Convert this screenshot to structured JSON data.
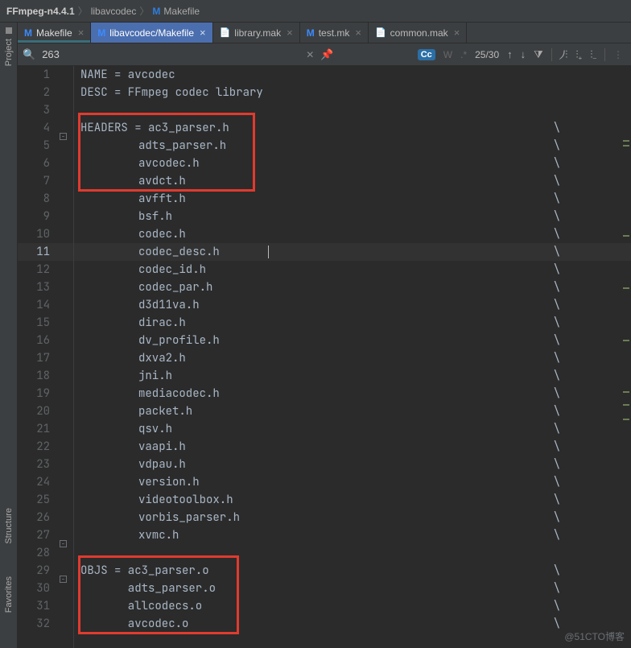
{
  "breadcrumb": {
    "root": "FFmpeg-n4.4.1",
    "folder": "libavcodec",
    "file": "Makefile"
  },
  "tabs": [
    {
      "icon": "M",
      "label": "Makefile",
      "active": false,
      "underline": true
    },
    {
      "icon": "M",
      "label": "libavcodec/Makefile",
      "active": true,
      "underline": false
    },
    {
      "icon": "F",
      "label": "library.mak",
      "active": false,
      "underline": false
    },
    {
      "icon": "M",
      "label": "test.mk",
      "active": false,
      "underline": false
    },
    {
      "icon": "F",
      "label": "common.mak",
      "active": false,
      "underline": false
    }
  ],
  "find": {
    "query": "263",
    "hits": "25/30",
    "cc": "Cc",
    "w": "W",
    "star": ".*",
    "up": "↑",
    "down": "↓",
    "filter": "⧩"
  },
  "side_tools": {
    "project": "Project",
    "structure": "Structure",
    "favorites": "Favorites"
  },
  "code": {
    "lines": [
      {
        "n": 1,
        "fold": "",
        "text": "NAME = avcodec",
        "bs": false
      },
      {
        "n": 2,
        "fold": "",
        "text": "DESC = FFmpeg codec library",
        "bs": false
      },
      {
        "n": 3,
        "fold": "",
        "text": "",
        "bs": false
      },
      {
        "n": 4,
        "fold": "-",
        "text": "HEADERS = ac3_parser.h",
        "bs": true
      },
      {
        "n": 5,
        "fold": "",
        "text": "",
        "pad": "adts_parser.h",
        "bs": true
      },
      {
        "n": 6,
        "fold": "",
        "text": "",
        "pad": "avcodec.h",
        "bs": true
      },
      {
        "n": 7,
        "fold": "",
        "text": "",
        "pad": "avdct.h",
        "bs": true
      },
      {
        "n": 8,
        "fold": "",
        "text": "",
        "pad": "avfft.h",
        "bs": true
      },
      {
        "n": 9,
        "fold": "",
        "text": "",
        "pad": "bsf.h",
        "bs": true
      },
      {
        "n": 10,
        "fold": "",
        "text": "",
        "pad": "codec.h",
        "bs": true
      },
      {
        "n": 11,
        "fold": "",
        "text": "",
        "pad": "codec_desc.h",
        "bs": true,
        "current": true
      },
      {
        "n": 12,
        "fold": "",
        "text": "",
        "pad": "codec_id.h",
        "bs": true
      },
      {
        "n": 13,
        "fold": "",
        "text": "",
        "pad": "codec_par.h",
        "bs": true
      },
      {
        "n": 14,
        "fold": "",
        "text": "",
        "pad": "d3d11va.h",
        "bs": true
      },
      {
        "n": 15,
        "fold": "",
        "text": "",
        "pad": "dirac.h",
        "bs": true
      },
      {
        "n": 16,
        "fold": "",
        "text": "",
        "pad": "dv_profile.h",
        "bs": true
      },
      {
        "n": 17,
        "fold": "",
        "text": "",
        "pad": "dxva2.h",
        "bs": true
      },
      {
        "n": 18,
        "fold": "",
        "text": "",
        "pad": "jni.h",
        "bs": true
      },
      {
        "n": 19,
        "fold": "",
        "text": "",
        "pad": "mediacodec.h",
        "bs": true
      },
      {
        "n": 20,
        "fold": "",
        "text": "",
        "pad": "packet.h",
        "bs": true
      },
      {
        "n": 21,
        "fold": "",
        "text": "",
        "pad": "qsv.h",
        "bs": true
      },
      {
        "n": 22,
        "fold": "",
        "text": "",
        "pad": "vaapi.h",
        "bs": true
      },
      {
        "n": 23,
        "fold": "",
        "text": "",
        "pad": "vdpau.h",
        "bs": true
      },
      {
        "n": 24,
        "fold": "",
        "text": "",
        "pad": "version.h",
        "bs": true
      },
      {
        "n": 25,
        "fold": "",
        "text": "",
        "pad": "videotoolbox.h",
        "bs": true
      },
      {
        "n": 26,
        "fold": "",
        "text": "",
        "pad": "vorbis_parser.h",
        "bs": true
      },
      {
        "n": 27,
        "fold": "-",
        "text": "",
        "pad": "xvmc.h",
        "bs": true
      },
      {
        "n": 28,
        "fold": "",
        "text": "",
        "bs": false
      },
      {
        "n": 29,
        "fold": "-",
        "text": "OBJS = ac3_parser.o",
        "bs": true
      },
      {
        "n": 30,
        "fold": "",
        "text": "",
        "pad2": "adts_parser.o",
        "bs": true
      },
      {
        "n": 31,
        "fold": "",
        "text": "",
        "pad2": "allcodecs.o",
        "bs": true
      },
      {
        "n": 32,
        "fold": "",
        "text": "",
        "pad2": "avcodec.o",
        "bs": true
      }
    ]
  },
  "watermark": "@51CTO博客"
}
